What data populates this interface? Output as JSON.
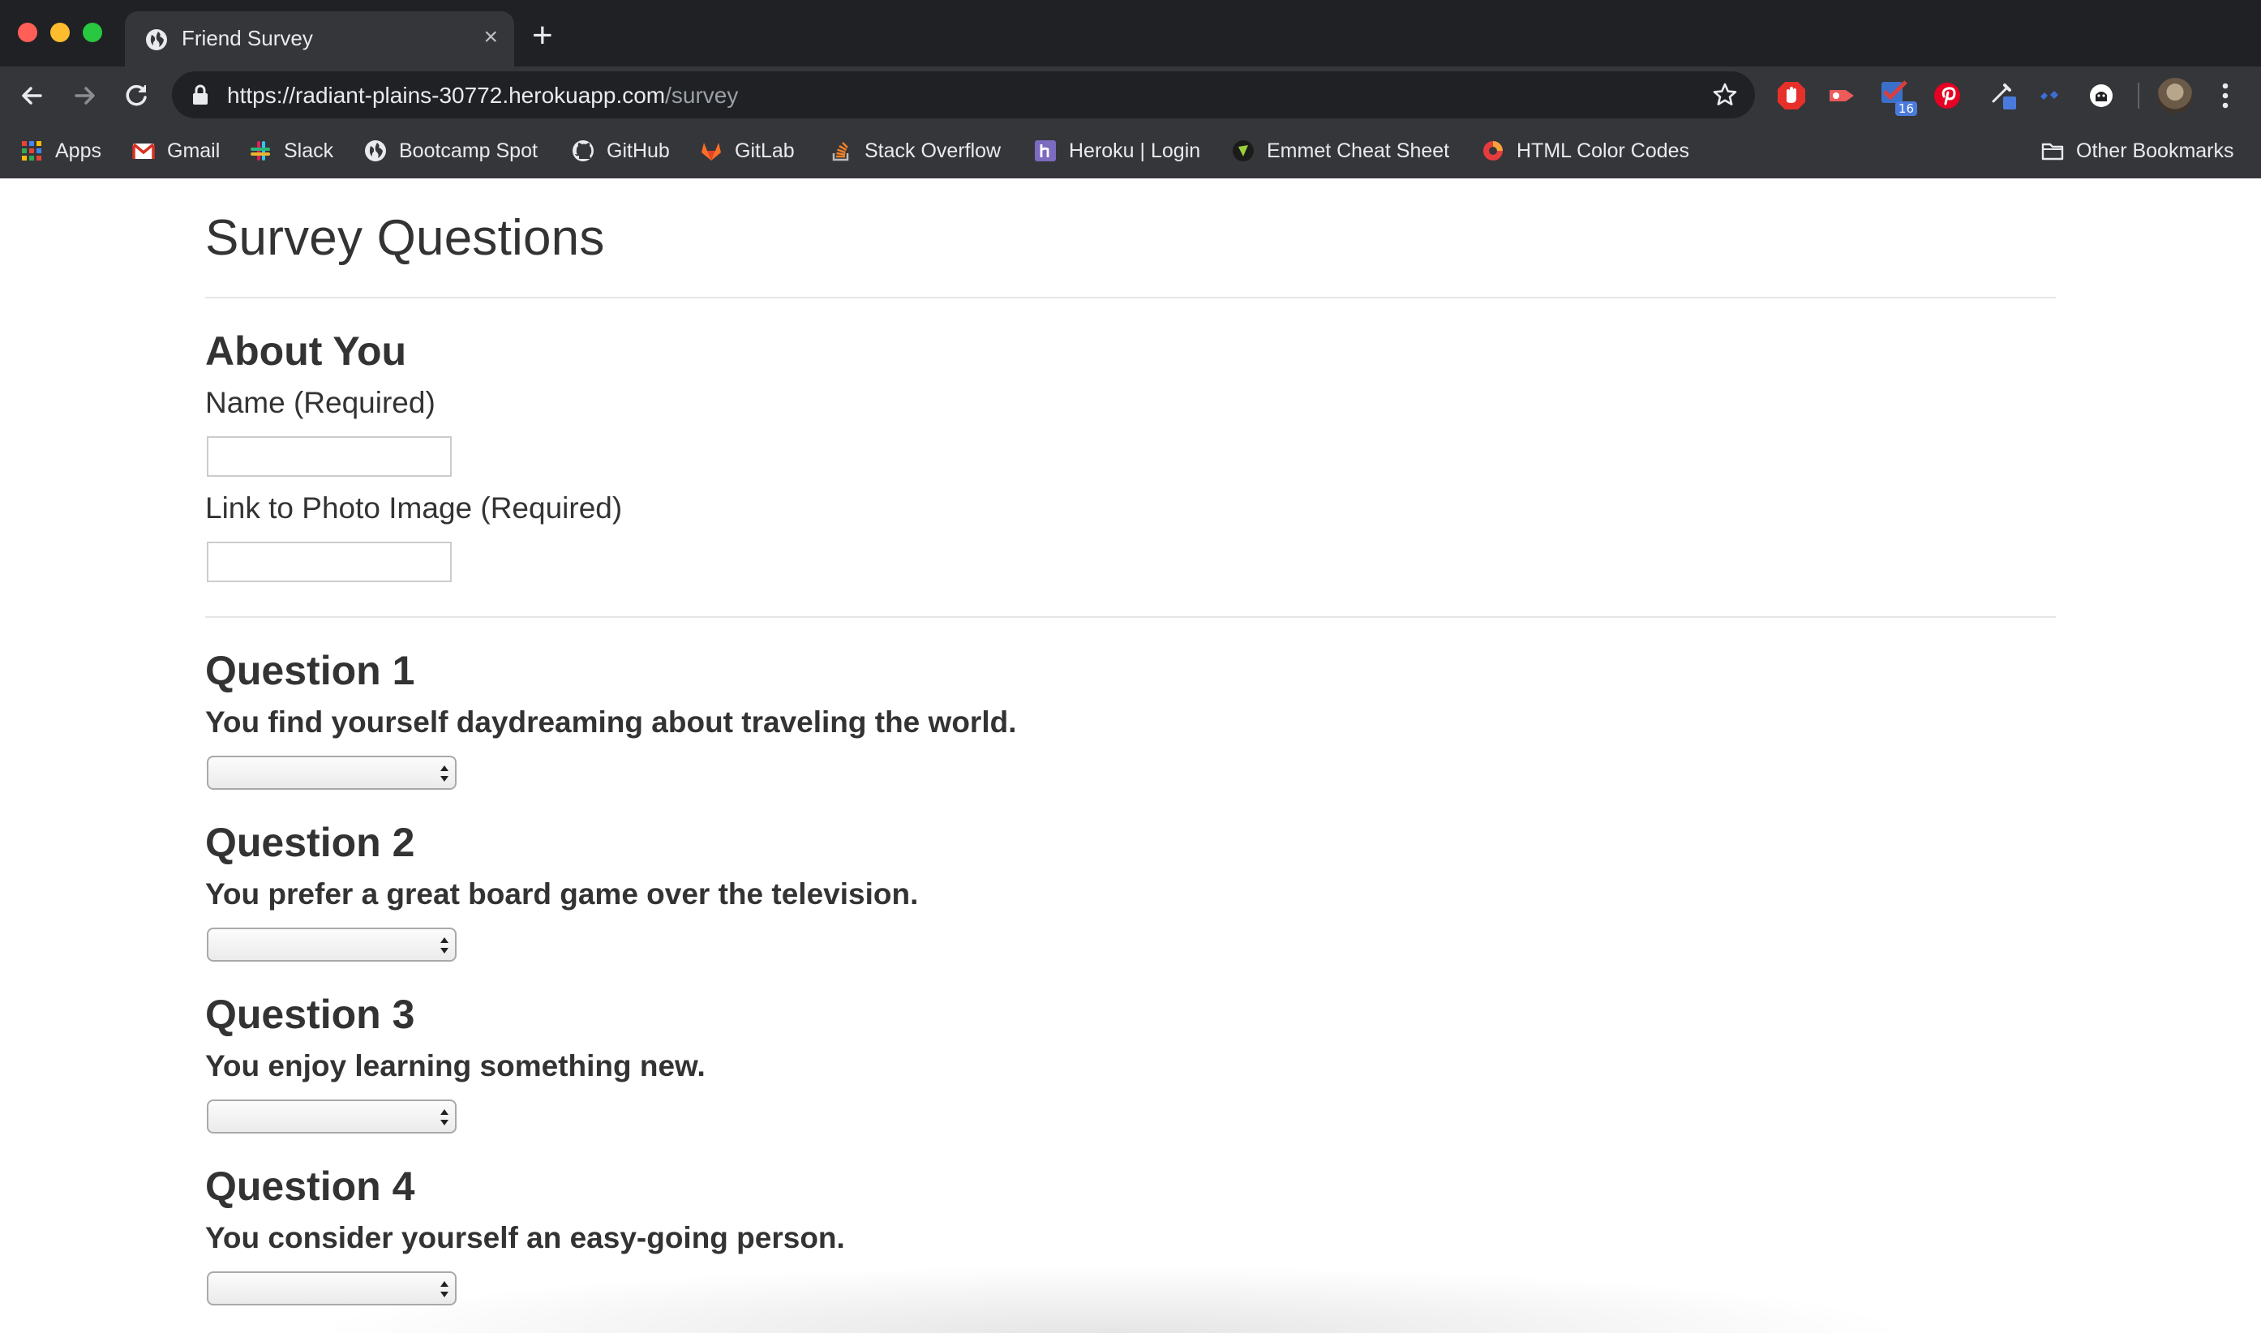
{
  "browser": {
    "tab": {
      "title": "Friend Survey",
      "close_glyph": "×",
      "favicon": "globe-icon"
    },
    "new_tab_glyph": "+",
    "url": {
      "scheme": "https://",
      "host": "radiant-plains-30772.herokuapp.com",
      "path": "/survey"
    },
    "extensions": [
      {
        "name": "adblock-icon",
        "color": "#e8302b"
      },
      {
        "name": "clip-extension-icon",
        "color": "#ee5a5a"
      },
      {
        "name": "todo-extension-icon",
        "color": "#d93f3f",
        "badge": "16"
      },
      {
        "name": "pinterest-icon",
        "color": "#e60023"
      },
      {
        "name": "eyedropper-icon",
        "color": "#4a7bdc"
      },
      {
        "name": "paste-extension-icon",
        "color": "#3b6fd8"
      },
      {
        "name": "ghostery-icon",
        "color": "#ffffff"
      }
    ],
    "bookmarks": [
      {
        "label": "Apps",
        "icon": "apps-grid-icon"
      },
      {
        "label": "Gmail",
        "icon": "gmail-icon"
      },
      {
        "label": "Slack",
        "icon": "slack-icon"
      },
      {
        "label": "Bootcamp Spot",
        "icon": "globe-icon"
      },
      {
        "label": "GitHub",
        "icon": "github-icon"
      },
      {
        "label": "GitLab",
        "icon": "gitlab-icon"
      },
      {
        "label": "Stack Overflow",
        "icon": "stackoverflow-icon"
      },
      {
        "label": "Heroku | Login",
        "icon": "heroku-icon"
      },
      {
        "label": "Emmet Cheat Sheet",
        "icon": "emmet-icon"
      },
      {
        "label": "HTML Color Codes",
        "icon": "color-wheel-icon"
      }
    ],
    "other_bookmarks": {
      "label": "Other Bookmarks",
      "icon": "folder-icon"
    }
  },
  "page": {
    "title": "Survey Questions",
    "about": {
      "heading": "About You",
      "name_label": "Name (Required)",
      "name_value": "",
      "photo_label": "Link to Photo Image (Required)",
      "photo_value": ""
    },
    "questions": [
      {
        "heading": "Question 1",
        "text": "You find yourself daydreaming about traveling the world.",
        "selected": ""
      },
      {
        "heading": "Question 2",
        "text": "You prefer a great board game over the television.",
        "selected": ""
      },
      {
        "heading": "Question 3",
        "text": "You enjoy learning something new.",
        "selected": ""
      },
      {
        "heading": "Question 4",
        "text": "You consider yourself an easy-going person.",
        "selected": ""
      }
    ]
  }
}
